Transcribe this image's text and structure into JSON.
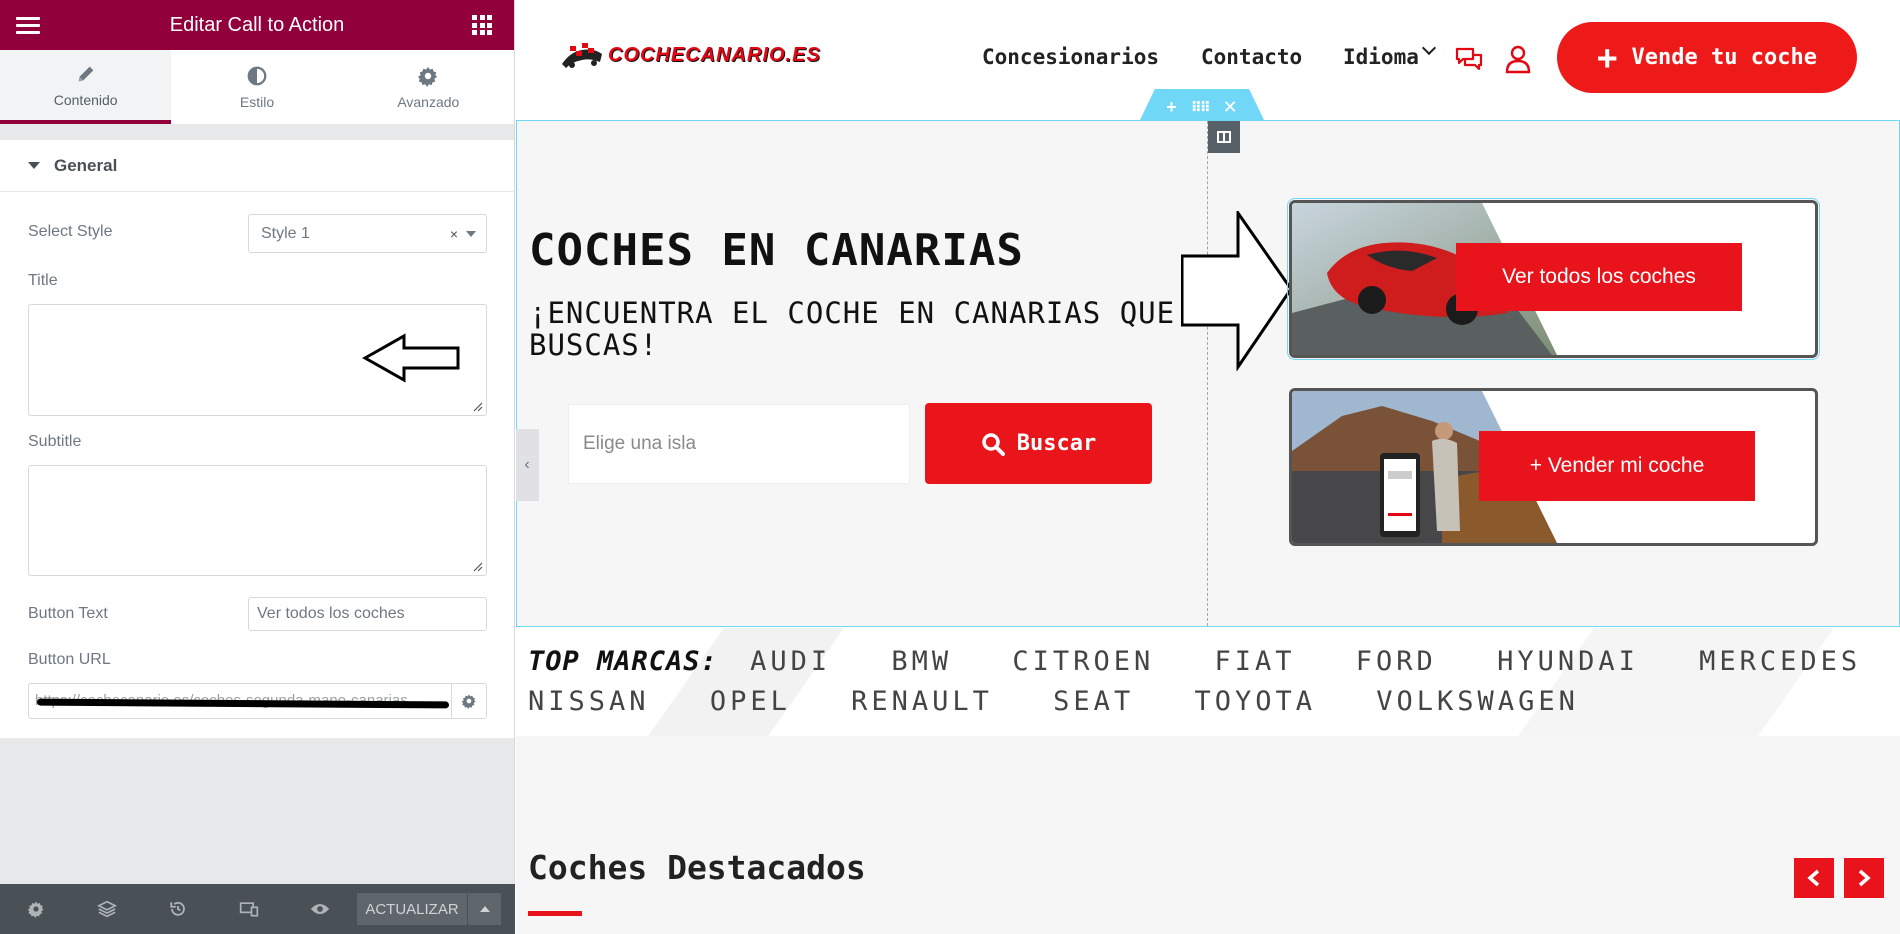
{
  "editor": {
    "header_title": "Editar Call to Action",
    "tabs": [
      {
        "label": "Contenido",
        "icon": "pencil-icon"
      },
      {
        "label": "Estilo",
        "icon": "half-circle-icon"
      },
      {
        "label": "Avanzado",
        "icon": "gear-icon"
      }
    ],
    "section_title": "General",
    "select_style_label": "Select Style",
    "select_style_value": "Style 1",
    "title_label": "Title",
    "title_value": "",
    "subtitle_label": "Subtitle",
    "subtitle_value": "",
    "button_text_label": "Button Text",
    "button_text_value": "Ver todos los coches",
    "button_url_label": "Button URL",
    "button_url_value": "https://cochecanario.es/coches-segunda-mano-canarias",
    "update_label": "ACTUALIZAR"
  },
  "site": {
    "logo_text": "COCHECANARIO.ES",
    "nav": [
      "Concesionarios",
      "Contacto",
      "Idioma"
    ],
    "sell_button": "Vende tu coche",
    "hero_title": "COCHES EN CANARIAS",
    "hero_subtitle": "¡ENCUENTRA EL COCHE EN CANARIAS QUE BUSCAS!",
    "island_placeholder": "Elige una isla",
    "search_button": "Buscar",
    "cta_buttons": [
      "Ver todos los coches",
      "+ Vender mi coche"
    ],
    "brands_lead": "TOP MARCAS:",
    "brands_line1": [
      "AUDI",
      "BMW",
      "CITROEN",
      "FIAT",
      "FORD",
      "HYUNDAI",
      "MERCEDES"
    ],
    "brands_line2": [
      "NISSAN",
      "OPEL",
      "RENAULT",
      "SEAT",
      "TOYOTA",
      "VOLKSWAGEN"
    ],
    "featured_title": "Coches Destacados"
  },
  "colors": {
    "editor_accent": "#92003b",
    "brand_red": "#e9141b",
    "selection_blue": "#71d7f7"
  }
}
